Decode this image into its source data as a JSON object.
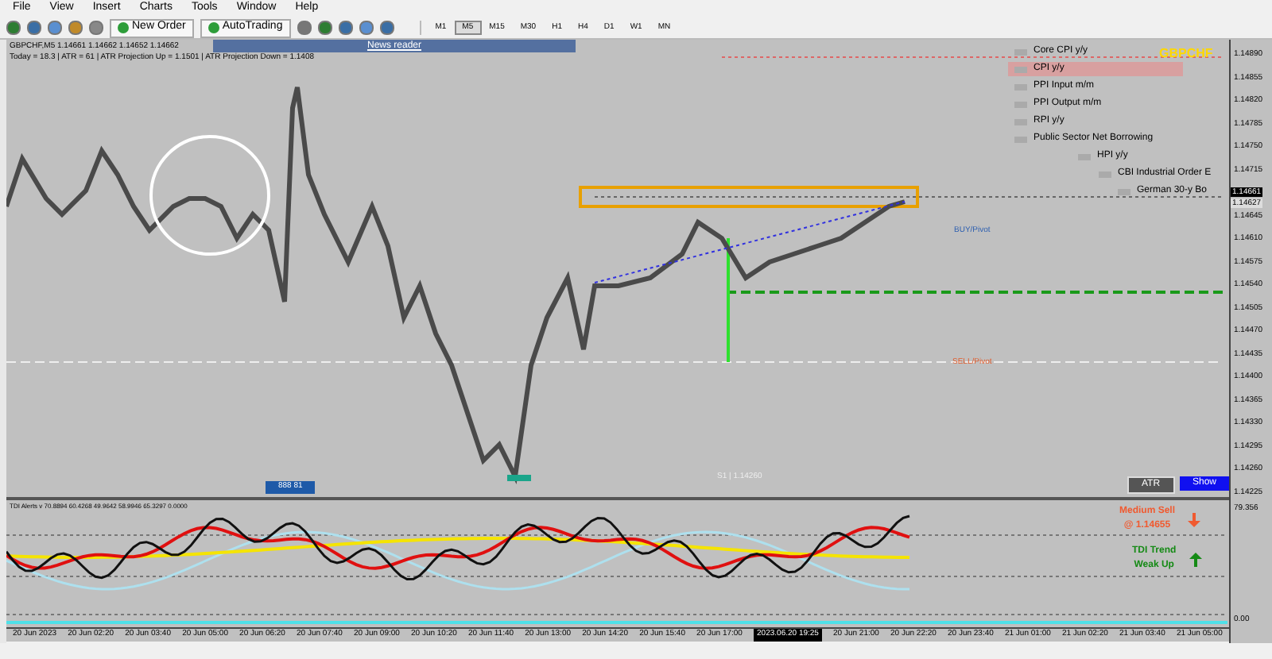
{
  "menu": [
    "File",
    "View",
    "Insert",
    "Charts",
    "Tools",
    "Window",
    "Help"
  ],
  "toolbar": {
    "buttons": [
      "New Order",
      "AutoTrading"
    ],
    "timeframes": [
      {
        "label": "M1",
        "selected": false
      },
      {
        "label": "M5",
        "selected": true
      },
      {
        "label": "M15",
        "selected": false
      },
      {
        "label": "M30",
        "selected": false
      },
      {
        "label": "H1",
        "selected": false
      },
      {
        "label": "H4",
        "selected": false
      },
      {
        "label": "D1",
        "selected": false
      },
      {
        "label": "W1",
        "selected": false
      },
      {
        "label": "MN",
        "selected": false
      }
    ]
  },
  "chart": {
    "info_line": "GBPCHF,M5  1.14661 1.14662 1.14652 1.14662",
    "stats_line": "Today = 18.3  |  ATR = 61  |  ATR Projection Up = 1.1501  |  ATR Projection Down = 1.1408",
    "news_reader": {
      "title": "News reader",
      "items": [
        {
          "label": "Core CPI y/y",
          "selected": false
        },
        {
          "label": "CPI y/y",
          "selected": true
        },
        {
          "label": "PPI Input m/m",
          "selected": false
        },
        {
          "label": "PPI Output m/m",
          "selected": false
        },
        {
          "label": "RPI y/y",
          "selected": false
        },
        {
          "label": "Public Sector Net Borrowing",
          "selected": false
        },
        {
          "label": "HPI y/y",
          "selected": false
        },
        {
          "label": "CBI Industrial Order E",
          "selected": false
        },
        {
          "label": "German 30-y Bo",
          "selected": false
        }
      ]
    },
    "symbol": "GBPCHF",
    "buy_label": "BUY/Pivot",
    "sell_label": "SELL/Pivot",
    "level_label": "S1 | 1.14260",
    "box_label": "888 81",
    "buttons": [
      "ATR",
      "Show"
    ],
    "signals": [
      {
        "kind": "sell",
        "lines": [
          "Medium Sell",
          "@ 1.14655"
        ]
      },
      {
        "kind": "up",
        "lines": [
          "TDI Trend",
          "Weak Up"
        ]
      }
    ],
    "price_axis": [
      "1.14890",
      "1.14855",
      "1.14820",
      "1.14785",
      "1.14750",
      "1.14715",
      "1.14645",
      "1.14610",
      "1.14575",
      "1.14540",
      "1.14505",
      "1.14470",
      "1.14435",
      "1.14400",
      "1.14365",
      "1.14330",
      "1.14295",
      "1.14260",
      "1.14225"
    ],
    "price_tags": [
      "1.14661",
      "1.14627"
    ]
  },
  "indicator": {
    "title": "TDI Alerts v 70.8894 60.4268 49.9642 58.9946 65.3297 0.0000",
    "axis": [
      "79.356",
      "0.00"
    ]
  },
  "time_axis": [
    {
      "label": "20 Jun 2023",
      "selected": false
    },
    {
      "label": "20 Jun 02:20",
      "selected": false
    },
    {
      "label": "20 Jun 03:40",
      "selected": false
    },
    {
      "label": "20 Jun 05:00",
      "selected": false
    },
    {
      "label": "20 Jun 06:20",
      "selected": false
    },
    {
      "label": "20 Jun 07:40",
      "selected": false
    },
    {
      "label": "20 Jun 09:00",
      "selected": false
    },
    {
      "label": "20 Jun 10:20",
      "selected": false
    },
    {
      "label": "20 Jun 11:40",
      "selected": false
    },
    {
      "label": "20 Jun 13:00",
      "selected": false
    },
    {
      "label": "20 Jun 14:20",
      "selected": false
    },
    {
      "label": "20 Jun 15:40",
      "selected": false
    },
    {
      "label": "20 Jun 17:00",
      "selected": false
    },
    {
      "label": "2023.06.20 19:25",
      "selected": true
    },
    {
      "label": "20 Jun 21:00",
      "selected": false
    },
    {
      "label": "20 Jun 22:20",
      "selected": false
    },
    {
      "label": "20 Jun 23:40",
      "selected": false
    },
    {
      "label": "21 Jun 01:00",
      "selected": false
    },
    {
      "label": "21 Jun 02:20",
      "selected": false
    },
    {
      "label": "21 Jun 03:40",
      "selected": false
    },
    {
      "label": "21 Jun 05:00",
      "selected": false
    }
  ]
}
